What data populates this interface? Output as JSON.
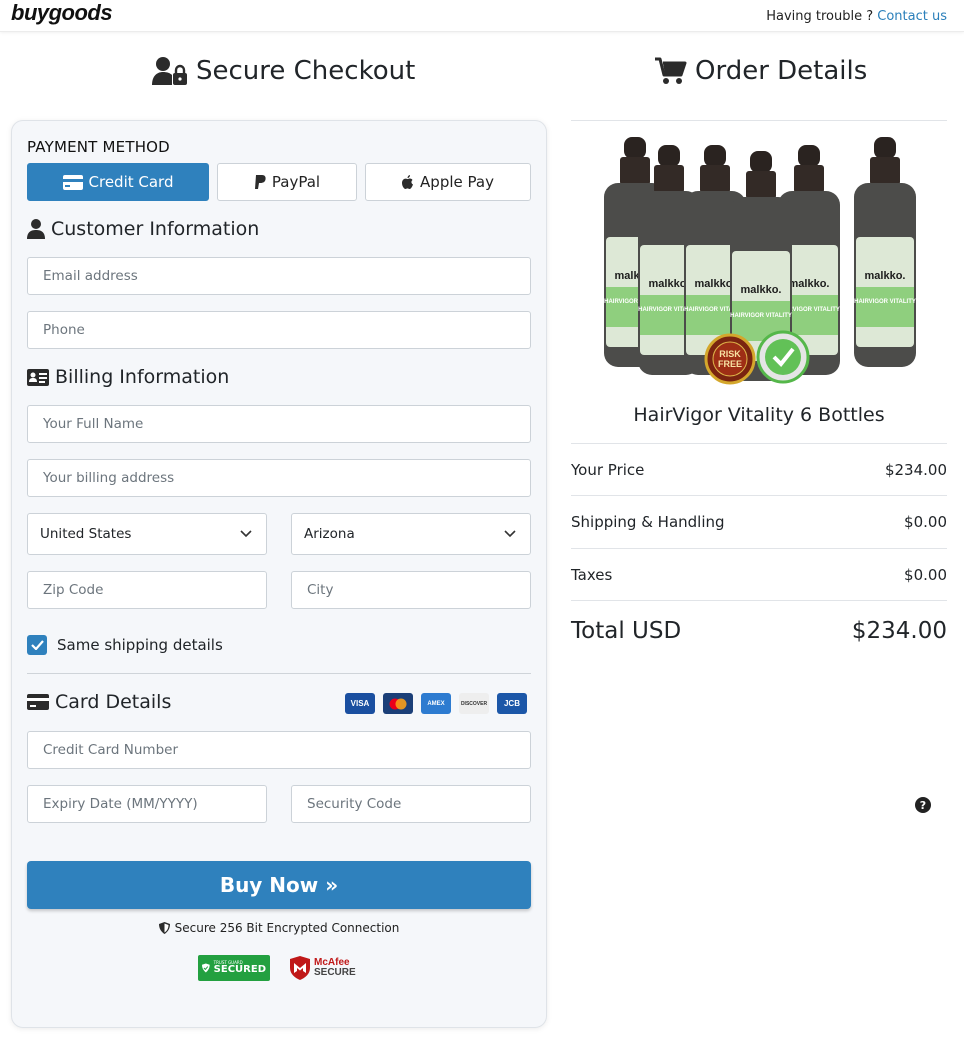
{
  "header": {
    "logo": "buygoods",
    "help_text": "Having trouble ?",
    "contact_link": "Contact us"
  },
  "checkout": {
    "title": "Secure Checkout",
    "payment_method_label": "PAYMENT METHOD",
    "methods": [
      {
        "label": "Credit Card",
        "icon": "credit-card-icon",
        "selected": true
      },
      {
        "label": "PayPal",
        "icon": "paypal-icon",
        "selected": false
      },
      {
        "label": "Apple Pay",
        "icon": "apple-icon",
        "selected": false
      }
    ],
    "customer_info_title": "Customer Information",
    "email_placeholder": "Email address",
    "phone_placeholder": "Phone",
    "billing_info_title": "Billing Information",
    "full_name_placeholder": "Your Full Name",
    "billing_address_placeholder": "Your billing address",
    "country_value": "United States",
    "state_value": "Arizona",
    "zip_placeholder": "Zip Code",
    "city_placeholder": "City",
    "same_shipping_label": "Same shipping details",
    "same_shipping_checked": true,
    "card_details_title": "Card Details",
    "card_logos": [
      "VISA",
      "MC",
      "AMEX",
      "DISCOVER",
      "JCB"
    ],
    "card_number_placeholder": "Credit Card Number",
    "expiry_placeholder": "Expiry Date (MM/YYYY)",
    "security_code_placeholder": "Security Code",
    "buy_button": "Buy Now »",
    "secure_text": "Secure 256 Bit Encrypted Connection",
    "trust_badge": {
      "small": "TRUST GUARD",
      "big": "SECURED"
    },
    "mcafee_badge": {
      "line1": "McAfee",
      "line2": "SECURE"
    }
  },
  "order": {
    "title": "Order Details",
    "product_name": "HairVigor Vitality 6 Bottles",
    "bottle_brand": "malkko.",
    "bottle_label": "HAIRVIGOR VITALITY",
    "risk_free_badge": "RISK FREE",
    "lines": [
      {
        "label": "Your Price",
        "value": "$234.00"
      },
      {
        "label": "Shipping & Handling",
        "value": "$0.00"
      },
      {
        "label": "Taxes",
        "value": "$0.00"
      }
    ],
    "total_label": "Total USD",
    "total_value": "$234.00"
  },
  "colors": {
    "primary": "#2f81bd",
    "card_bg": "#f5f7fa",
    "link": "#2a7fba",
    "trust_green": "#23a040"
  }
}
